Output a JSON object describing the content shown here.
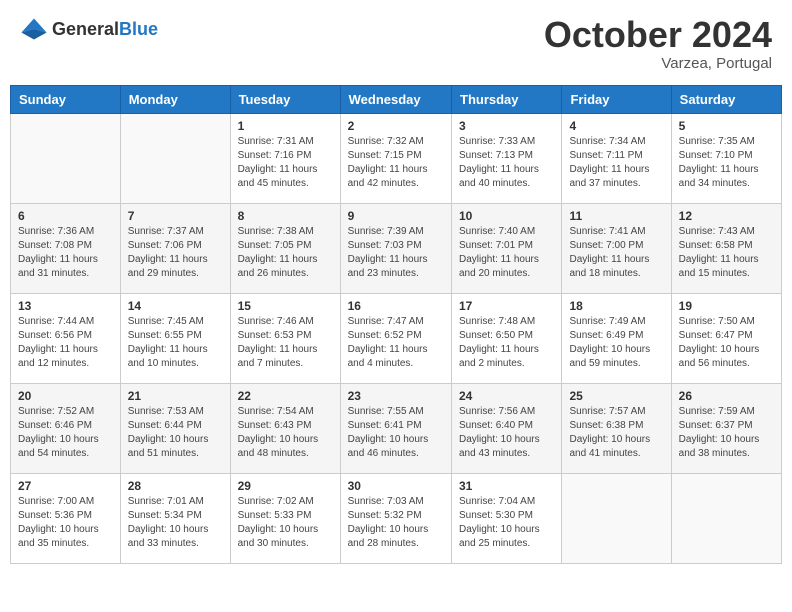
{
  "header": {
    "logo_general": "General",
    "logo_blue": "Blue",
    "month_title": "October 2024",
    "location": "Varzea, Portugal"
  },
  "days_of_week": [
    "Sunday",
    "Monday",
    "Tuesday",
    "Wednesday",
    "Thursday",
    "Friday",
    "Saturday"
  ],
  "weeks": [
    [
      {
        "day": "",
        "info": ""
      },
      {
        "day": "",
        "info": ""
      },
      {
        "day": "1",
        "info": "Sunrise: 7:31 AM\nSunset: 7:16 PM\nDaylight: 11 hours and 45 minutes."
      },
      {
        "day": "2",
        "info": "Sunrise: 7:32 AM\nSunset: 7:15 PM\nDaylight: 11 hours and 42 minutes."
      },
      {
        "day": "3",
        "info": "Sunrise: 7:33 AM\nSunset: 7:13 PM\nDaylight: 11 hours and 40 minutes."
      },
      {
        "day": "4",
        "info": "Sunrise: 7:34 AM\nSunset: 7:11 PM\nDaylight: 11 hours and 37 minutes."
      },
      {
        "day": "5",
        "info": "Sunrise: 7:35 AM\nSunset: 7:10 PM\nDaylight: 11 hours and 34 minutes."
      }
    ],
    [
      {
        "day": "6",
        "info": "Sunrise: 7:36 AM\nSunset: 7:08 PM\nDaylight: 11 hours and 31 minutes."
      },
      {
        "day": "7",
        "info": "Sunrise: 7:37 AM\nSunset: 7:06 PM\nDaylight: 11 hours and 29 minutes."
      },
      {
        "day": "8",
        "info": "Sunrise: 7:38 AM\nSunset: 7:05 PM\nDaylight: 11 hours and 26 minutes."
      },
      {
        "day": "9",
        "info": "Sunrise: 7:39 AM\nSunset: 7:03 PM\nDaylight: 11 hours and 23 minutes."
      },
      {
        "day": "10",
        "info": "Sunrise: 7:40 AM\nSunset: 7:01 PM\nDaylight: 11 hours and 20 minutes."
      },
      {
        "day": "11",
        "info": "Sunrise: 7:41 AM\nSunset: 7:00 PM\nDaylight: 11 hours and 18 minutes."
      },
      {
        "day": "12",
        "info": "Sunrise: 7:43 AM\nSunset: 6:58 PM\nDaylight: 11 hours and 15 minutes."
      }
    ],
    [
      {
        "day": "13",
        "info": "Sunrise: 7:44 AM\nSunset: 6:56 PM\nDaylight: 11 hours and 12 minutes."
      },
      {
        "day": "14",
        "info": "Sunrise: 7:45 AM\nSunset: 6:55 PM\nDaylight: 11 hours and 10 minutes."
      },
      {
        "day": "15",
        "info": "Sunrise: 7:46 AM\nSunset: 6:53 PM\nDaylight: 11 hours and 7 minutes."
      },
      {
        "day": "16",
        "info": "Sunrise: 7:47 AM\nSunset: 6:52 PM\nDaylight: 11 hours and 4 minutes."
      },
      {
        "day": "17",
        "info": "Sunrise: 7:48 AM\nSunset: 6:50 PM\nDaylight: 11 hours and 2 minutes."
      },
      {
        "day": "18",
        "info": "Sunrise: 7:49 AM\nSunset: 6:49 PM\nDaylight: 10 hours and 59 minutes."
      },
      {
        "day": "19",
        "info": "Sunrise: 7:50 AM\nSunset: 6:47 PM\nDaylight: 10 hours and 56 minutes."
      }
    ],
    [
      {
        "day": "20",
        "info": "Sunrise: 7:52 AM\nSunset: 6:46 PM\nDaylight: 10 hours and 54 minutes."
      },
      {
        "day": "21",
        "info": "Sunrise: 7:53 AM\nSunset: 6:44 PM\nDaylight: 10 hours and 51 minutes."
      },
      {
        "day": "22",
        "info": "Sunrise: 7:54 AM\nSunset: 6:43 PM\nDaylight: 10 hours and 48 minutes."
      },
      {
        "day": "23",
        "info": "Sunrise: 7:55 AM\nSunset: 6:41 PM\nDaylight: 10 hours and 46 minutes."
      },
      {
        "day": "24",
        "info": "Sunrise: 7:56 AM\nSunset: 6:40 PM\nDaylight: 10 hours and 43 minutes."
      },
      {
        "day": "25",
        "info": "Sunrise: 7:57 AM\nSunset: 6:38 PM\nDaylight: 10 hours and 41 minutes."
      },
      {
        "day": "26",
        "info": "Sunrise: 7:59 AM\nSunset: 6:37 PM\nDaylight: 10 hours and 38 minutes."
      }
    ],
    [
      {
        "day": "27",
        "info": "Sunrise: 7:00 AM\nSunset: 5:36 PM\nDaylight: 10 hours and 35 minutes."
      },
      {
        "day": "28",
        "info": "Sunrise: 7:01 AM\nSunset: 5:34 PM\nDaylight: 10 hours and 33 minutes."
      },
      {
        "day": "29",
        "info": "Sunrise: 7:02 AM\nSunset: 5:33 PM\nDaylight: 10 hours and 30 minutes."
      },
      {
        "day": "30",
        "info": "Sunrise: 7:03 AM\nSunset: 5:32 PM\nDaylight: 10 hours and 28 minutes."
      },
      {
        "day": "31",
        "info": "Sunrise: 7:04 AM\nSunset: 5:30 PM\nDaylight: 10 hours and 25 minutes."
      },
      {
        "day": "",
        "info": ""
      },
      {
        "day": "",
        "info": ""
      }
    ]
  ]
}
